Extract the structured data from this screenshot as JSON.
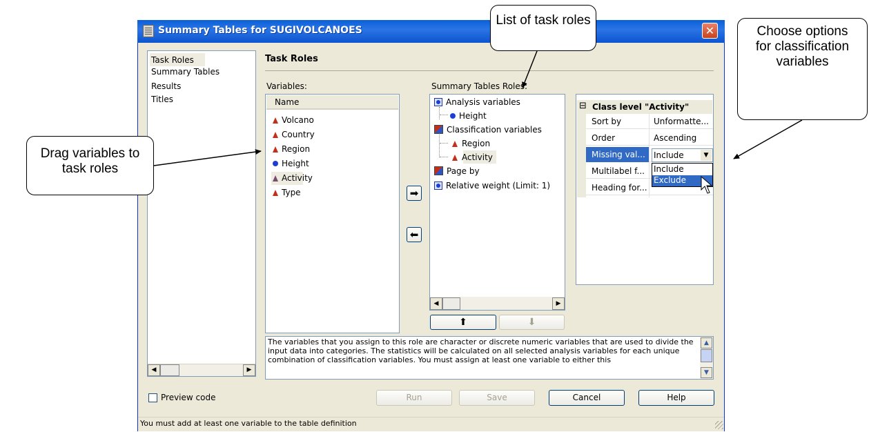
{
  "window": {
    "title": "Summary Tables for SUGIVOLCANOES",
    "close_label": "✕"
  },
  "nav": {
    "items": [
      "Task Roles",
      "Summary Tables",
      "Results",
      "Titles"
    ]
  },
  "section_title": "Task Roles",
  "variables": {
    "label": "Variables:",
    "column_header": "Name",
    "items": [
      {
        "name": "Volcano",
        "icon": "character-variable-icon"
      },
      {
        "name": "Country",
        "icon": "character-variable-icon"
      },
      {
        "name": "Region",
        "icon": "character-variable-icon"
      },
      {
        "name": "Height",
        "icon": "numeric-variable-icon"
      },
      {
        "name": "Activity",
        "icon": "character-variable-icon"
      },
      {
        "name": "Type",
        "icon": "character-variable-icon"
      }
    ]
  },
  "roles": {
    "label": "Summary Tables Roles:",
    "items": [
      {
        "label": "Analysis variables"
      },
      {
        "label": "Height"
      },
      {
        "label": "Classification variables"
      },
      {
        "label": "Region"
      },
      {
        "label": "Activity"
      },
      {
        "label": "Page by"
      },
      {
        "label": "Relative weight  (Limit: 1)"
      }
    ]
  },
  "properties": {
    "header": "Class level \"Activity\"",
    "collapse_glyph": "⊟",
    "rows": [
      {
        "key": "Sort by",
        "value": "Unformatte..."
      },
      {
        "key": "Order",
        "value": "Ascending"
      },
      {
        "key": "Missing val...",
        "value": "Include"
      },
      {
        "key": "Multilabel f...",
        "value": ""
      },
      {
        "key": "Heading for...",
        "value": ""
      }
    ],
    "dropdown_options": [
      "Include",
      "Exclude"
    ]
  },
  "description": "The variables that you assign to this role are character or discrete numeric variables that are used to divide the input data into categories. The statistics will be calculated on all selected analysis variables for each unique combination of classification variables. You must assign at least one variable to either this",
  "preview_code_label": "Preview code",
  "buttons": {
    "run": "Run",
    "save": "Save",
    "cancel": "Cancel",
    "help": "Help"
  },
  "status": "You must add at least one variable to the table definition",
  "callouts": {
    "list_roles": "List of task roles",
    "choose_options": "Choose options for classification variables",
    "drag": "Drag variables to task roles"
  },
  "glyphs": {
    "right_arrow": "➡",
    "left_arrow": "⬅",
    "up_arrow": "⬆",
    "down_arrow": "⬇",
    "scroll_left": "◀",
    "scroll_right": "▶",
    "scroll_up": "▲",
    "scroll_down": "▼"
  }
}
